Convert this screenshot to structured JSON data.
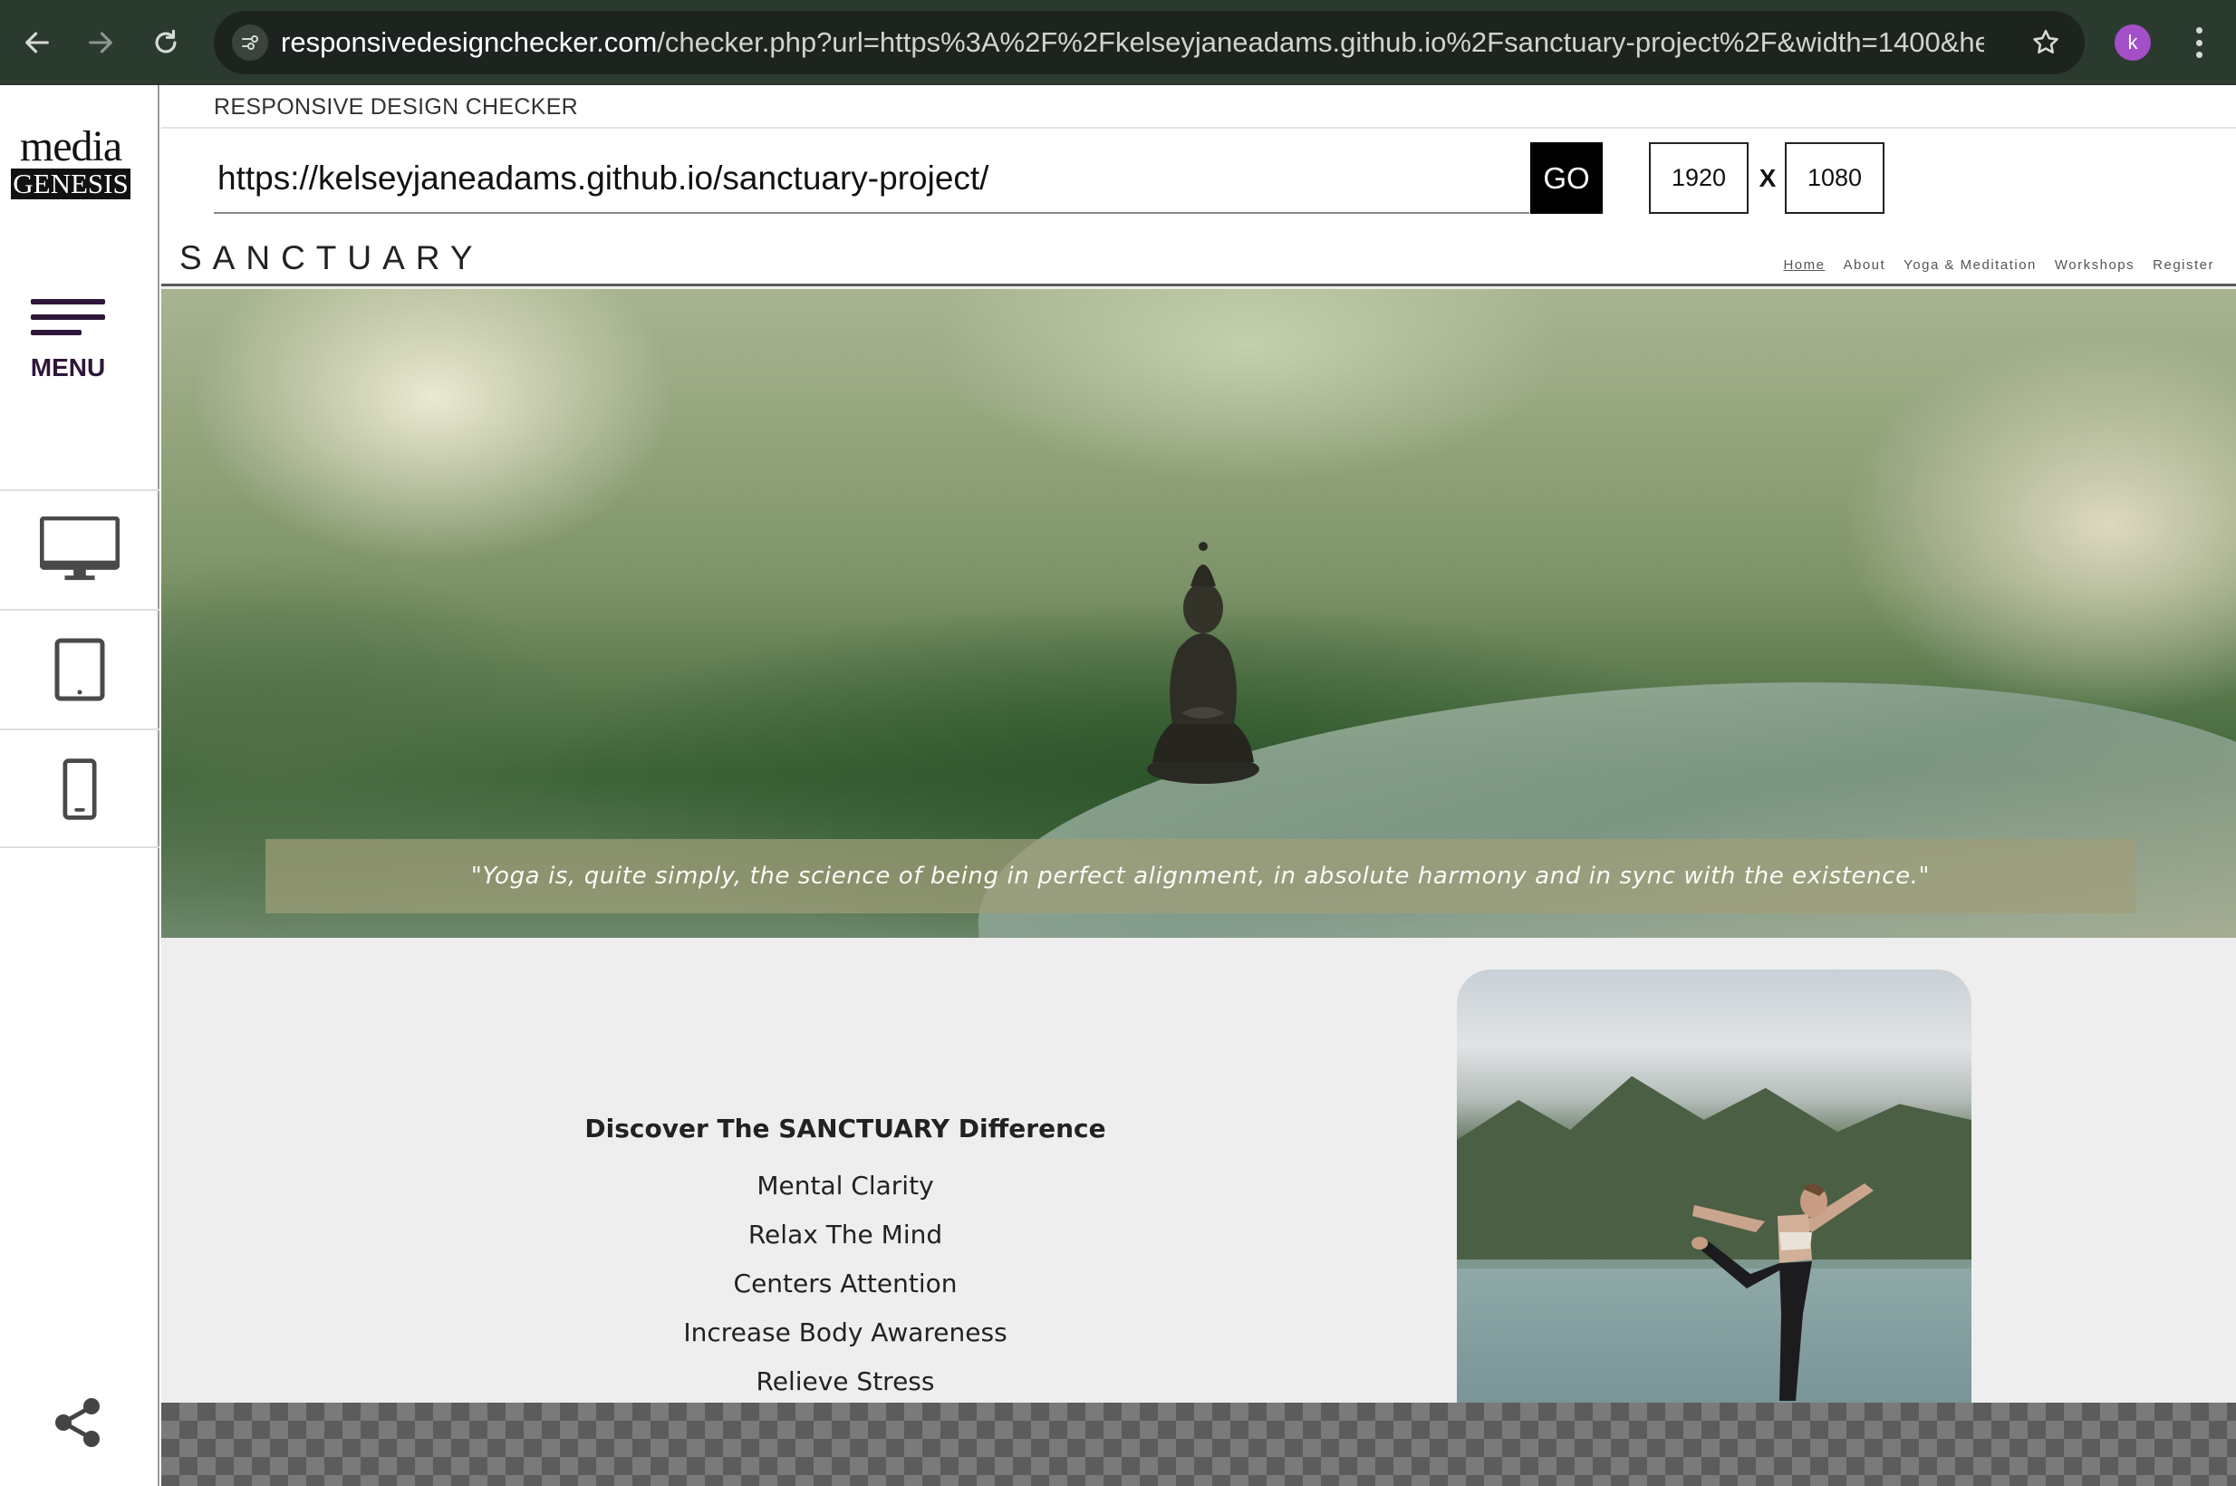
{
  "browser": {
    "url_host": "responsivedesignchecker.com",
    "url_rest": "/checker.php?url=https%3A%2F%2Fkelseyjaneadams.github.io%2Fsanctuary-project%2F&width=1400&height=...",
    "profile_initial": "k",
    "icons": [
      "back-arrow-icon",
      "forward-arrow-icon",
      "reload-icon",
      "site-info-icon",
      "star-icon",
      "kebab-menu-icon"
    ]
  },
  "checker": {
    "logo_top": "media",
    "logo_bottom": "GENESIS",
    "menu_label": "MENU",
    "devices": [
      "desktop-icon",
      "tablet-icon",
      "phone-icon"
    ],
    "share_icon": "share-icon",
    "title": "RESPONSIVE DESIGN CHECKER",
    "url_value": "https://kelseyjaneadams.github.io/sanctuary-project/",
    "go_label": "GO",
    "width": "1920",
    "separator": "X",
    "height": "1080",
    "accent": "#2e1638"
  },
  "site": {
    "brand": "SANCTUARY",
    "nav": [
      "Home",
      "About",
      "Yoga & Meditation",
      "Workshops",
      "Register"
    ],
    "active_nav": "Home",
    "quote": "\"Yoga is, quite simply, the science of being in perfect alignment, in absolute harmony and in sync with the existence.\"",
    "benefits_title": "Discover The SANCTUARY Difference",
    "benefits": [
      "Mental Clarity",
      "Relax The Mind",
      "Centers Attention",
      "Increase Body Awareness",
      "Relieve Stress"
    ]
  }
}
